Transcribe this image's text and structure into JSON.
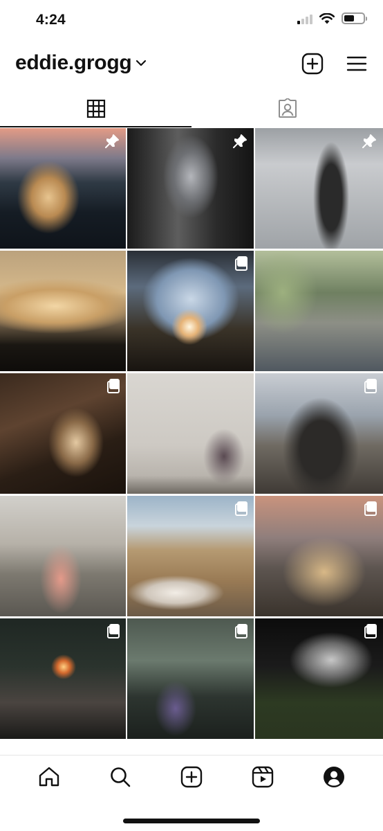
{
  "status_bar": {
    "time": "4:24",
    "signal_bars_active": 1,
    "battery_level": 0.55
  },
  "header": {
    "username": "eddie.grogg",
    "icons": [
      "chevron-down-icon",
      "new-post-icon",
      "menu-icon"
    ]
  },
  "tabs": [
    {
      "name": "grid-tab",
      "icon": "grid-icon",
      "active": true
    },
    {
      "name": "tagged-tab",
      "icon": "tagged-user-icon",
      "active": false
    }
  ],
  "posts": [
    {
      "badge": "pin-icon"
    },
    {
      "badge": "pin-icon"
    },
    {
      "badge": "pin-icon"
    },
    {
      "badge": null
    },
    {
      "badge": "carousel-icon"
    },
    {
      "badge": null
    },
    {
      "badge": "carousel-icon"
    },
    {
      "badge": null
    },
    {
      "badge": "carousel-icon"
    },
    {
      "badge": null
    },
    {
      "badge": "carousel-icon"
    },
    {
      "badge": "carousel-icon"
    },
    {
      "badge": "carousel-icon"
    },
    {
      "badge": "carousel-icon"
    },
    {
      "badge": "carousel-icon"
    }
  ],
  "bottom_nav": [
    "home-icon",
    "search-icon",
    "create-icon",
    "reels-icon",
    "profile-icon"
  ],
  "colors": {
    "text": "#111111",
    "background": "#ffffff",
    "divider": "#e6e6e6"
  }
}
